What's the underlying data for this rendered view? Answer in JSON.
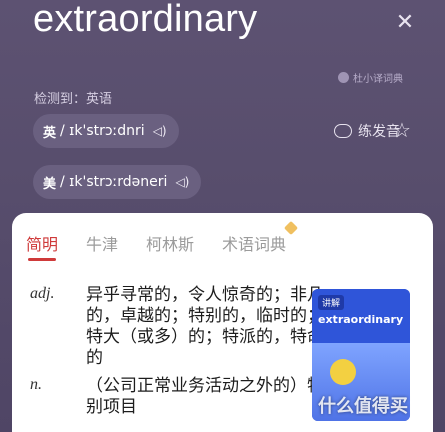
{
  "header": {
    "word": "extraordinary",
    "close_icon": "close-icon",
    "source": "杜小译词典",
    "detected_label": "检测到：英语"
  },
  "pronunciations": [
    {
      "label": "英",
      "ipa": "/ ɪk'strɔːdnri",
      "speaker_icon": "speaker-icon"
    },
    {
      "label": "美",
      "ipa": "/ ɪk'strɔːrdəneri",
      "speaker_icon": "speaker-icon"
    }
  ],
  "actions": {
    "practice_label": "练发音",
    "favorite_icon": "star-icon"
  },
  "tabs": [
    {
      "label": "简明",
      "active": true
    },
    {
      "label": "牛津",
      "active": false
    },
    {
      "label": "柯林斯",
      "active": false
    },
    {
      "label": "术语词典",
      "active": false
    }
  ],
  "definitions": [
    {
      "pos": "adj.",
      "text": "异乎寻常的，令人惊奇的；非凡的，卓越的；特别的，临时的；特大（或多）的；特派的，特命的"
    },
    {
      "pos": "n.",
      "text": "（公司正常业务活动之外的）特别项目"
    }
  ],
  "thumbnail": {
    "tag": "讲解",
    "word": "extraordinary"
  },
  "watermark": "什么值得买"
}
